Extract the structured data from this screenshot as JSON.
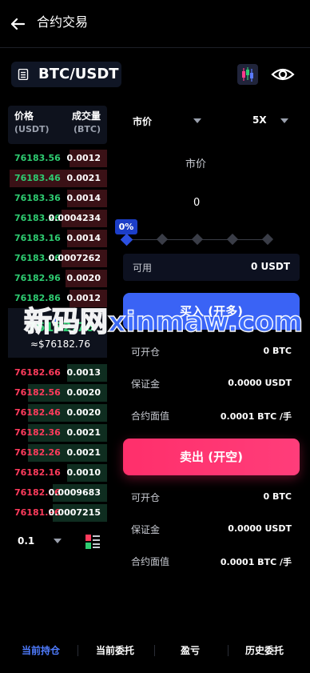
{
  "header": {
    "title": "合约交易"
  },
  "pair": {
    "label": "BTC/USDT"
  },
  "orderbook": {
    "price_header": "价格",
    "price_unit": "(USDT)",
    "qty_header": "成交量",
    "qty_unit": "(BTC)",
    "asks": [
      {
        "price": "76183.56",
        "qty": "0.0012",
        "depth": 0.38
      },
      {
        "price": "76183.46",
        "qty": "0.0021",
        "depth": 0.98
      },
      {
        "price": "76183.36",
        "qty": "0.0014",
        "depth": 0.4
      },
      {
        "price": "76183.26",
        "qty": "0.0004234",
        "depth": 0.46
      },
      {
        "price": "76183.16",
        "qty": "0.0014",
        "depth": 0.4
      },
      {
        "price": "76183.06",
        "qty": "0.0007262",
        "depth": 0.46
      },
      {
        "price": "76182.96",
        "qty": "0.0020",
        "depth": 0.42
      },
      {
        "price": "76182.86",
        "qty": "0.0012",
        "depth": 0.38
      }
    ],
    "mid_price": "76182.76",
    "mid_fiat": "≈$76182.76",
    "bids": [
      {
        "price": "76182.66",
        "qty": "0.0013",
        "depth": 0.4
      },
      {
        "price": "76182.56",
        "qty": "0.0020",
        "depth": 0.8
      },
      {
        "price": "76182.46",
        "qty": "0.0020",
        "depth": 0.8
      },
      {
        "price": "76182.36",
        "qty": "0.0021",
        "depth": 0.8
      },
      {
        "price": "76182.26",
        "qty": "0.0021",
        "depth": 0.8
      },
      {
        "price": "76182.16",
        "qty": "0.0010",
        "depth": 0.4
      },
      {
        "price": "76182.06",
        "qty": "0.0009683",
        "depth": 0.55
      },
      {
        "price": "76181.96",
        "qty": "0.0007215",
        "depth": 0.55
      }
    ],
    "depth_value": "0.1"
  },
  "form": {
    "order_type": "市价",
    "leverage": "5X",
    "price_placeholder": "市价",
    "amount": "0",
    "slider_percent": "0%",
    "available_label": "可用",
    "available_value": "0 USDT",
    "buy_button": "买入 (开多)",
    "sell_button": "卖出 (开空)",
    "buy_info": [
      {
        "label": "可开仓",
        "value": "0 BTC"
      },
      {
        "label": "保证金",
        "value": "0.0000 USDT"
      },
      {
        "label": "合约面值",
        "value": "0.0001 BTC /手"
      }
    ],
    "sell_info": [
      {
        "label": "可开仓",
        "value": "0 BTC"
      },
      {
        "label": "保证金",
        "value": "0.0000 USDT"
      },
      {
        "label": "合约面值",
        "value": "0.0001 BTC /手"
      }
    ]
  },
  "watermark": "新码网xinmaw.com",
  "tabs": [
    "当前持仓",
    "当前委托",
    "盈亏",
    "历史委托"
  ],
  "colors": {
    "accent": "#4f7cff",
    "ask": "#2ecc71",
    "bid": "#ff3b5c",
    "sell": "#ff2f6b",
    "buy": "#3a63f5"
  }
}
